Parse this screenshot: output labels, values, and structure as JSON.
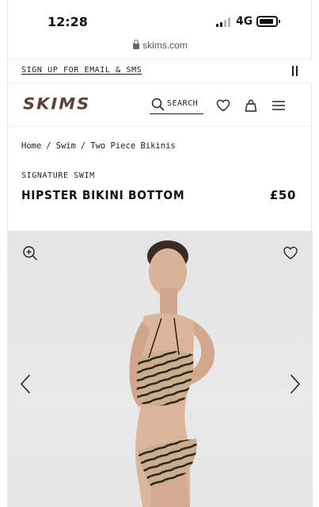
{
  "status_bar": {
    "time": "12:28",
    "network": "4G"
  },
  "browser": {
    "url": "skims.com"
  },
  "promo": {
    "label": "SIGN UP FOR EMAIL & SMS"
  },
  "header": {
    "logo": "SKIMS",
    "search_label": "SEARCH",
    "brand_color": "#5b4136"
  },
  "breadcrumb": [
    "Home",
    "Swim",
    "Two Piece Bikinis"
  ],
  "product": {
    "collection": "SIGNATURE SWIM",
    "name": "HIPSTER BIKINI BOTTOM",
    "price": "£50"
  },
  "gallery": {
    "icons": [
      "zoom-in-icon",
      "heart-icon",
      "chevron-left-icon",
      "chevron-right-icon"
    ],
    "background": "#e6e6e6"
  }
}
